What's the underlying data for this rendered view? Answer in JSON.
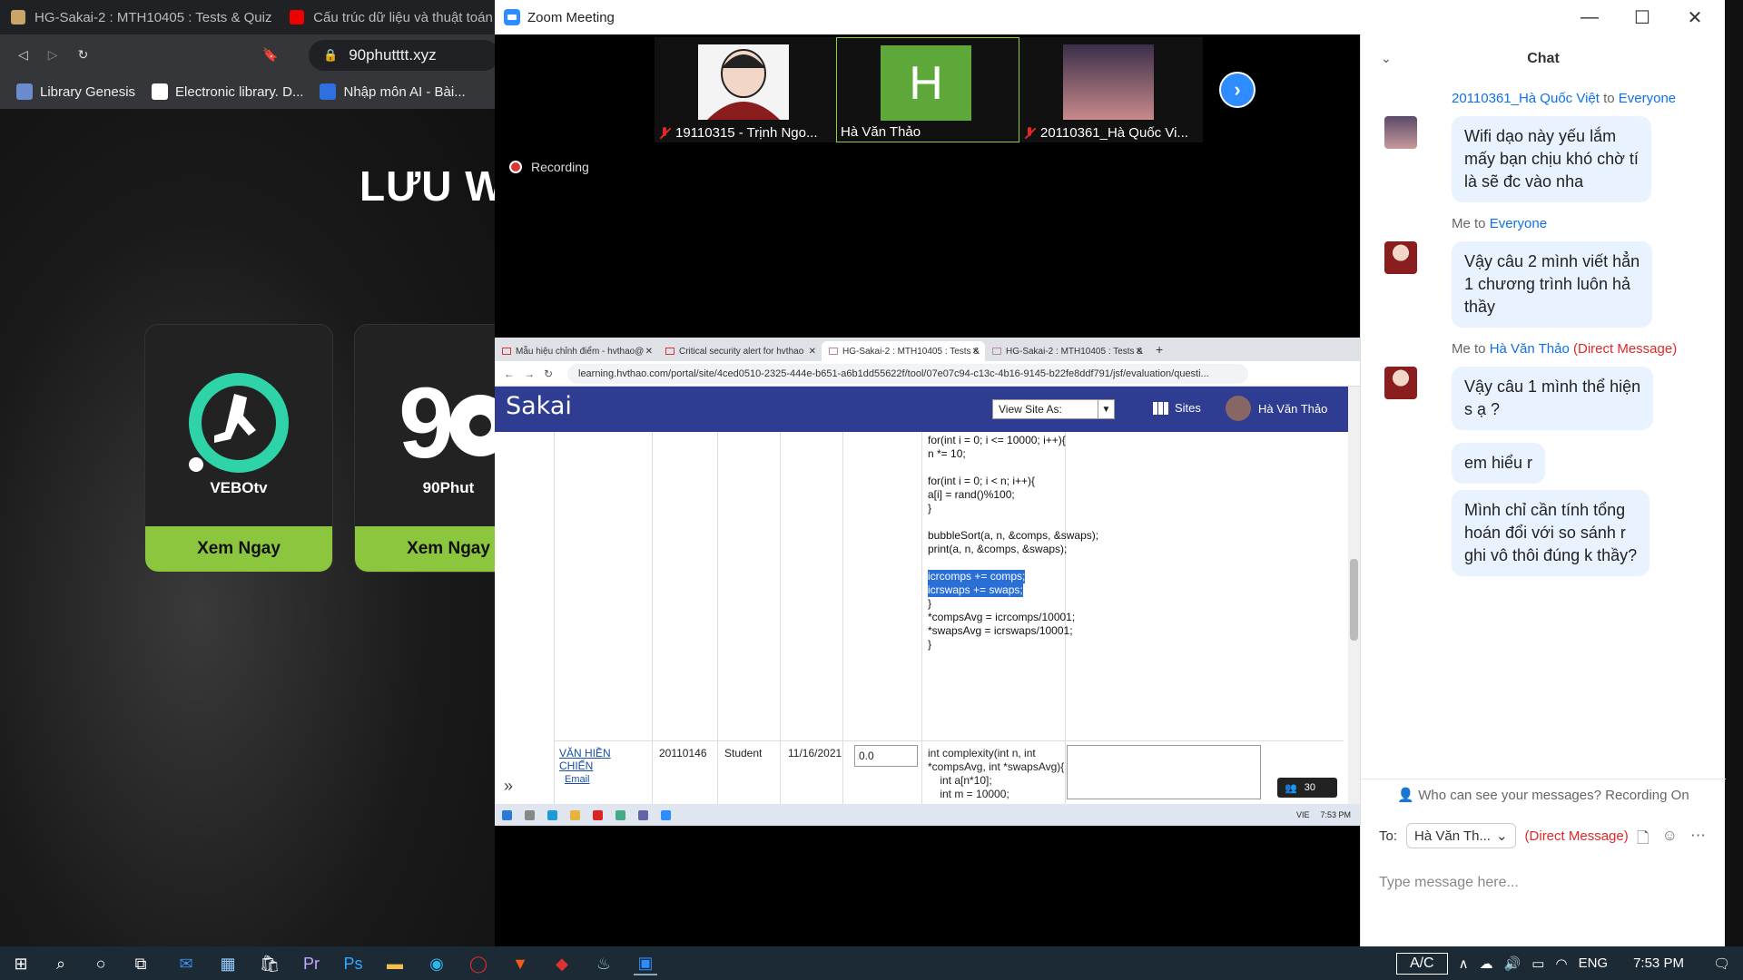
{
  "bg_browser": {
    "tabs": [
      {
        "title": "HG-Sakai-2 : MTH10405 : Tests & Quiz",
        "icon": "sakai-favicon"
      },
      {
        "title": "Cấu trúc dữ liệu và thuật toán",
        "icon": "youtube-favicon"
      }
    ],
    "url": "90phutttt.xyz",
    "bookmarks": [
      "Library Genesis",
      "Electronic library. D...",
      "Nhập môn AI - Bài..."
    ],
    "heading": "LƯU W",
    "cards": [
      {
        "name": "VEBOtv",
        "button": "Xem Ngay"
      },
      {
        "name": "90Phut",
        "button": "Xem Ngay"
      }
    ]
  },
  "zoom": {
    "title": "Zoom Meeting",
    "participants": [
      {
        "name": "19110315 - Trịnh Ngo...",
        "muted": true
      },
      {
        "name": "Hà Văn Thảo",
        "muted": false,
        "initial": "H"
      },
      {
        "name": "20110361_Hà Quốc Vi...",
        "muted": true
      }
    ],
    "recording_label": "Recording",
    "shared": {
      "tabs": [
        "Mẫu hiệu chỉnh điểm - hvthao@",
        "Critical security alert for hvthao",
        "HG-Sakai-2 : MTH10405 : Tests &",
        "HG-Sakai-2 : MTH10405 : Tests &"
      ],
      "url": "learning.hvthao.com/portal/site/4ced0510-2325-444e-b651-a6b1dd55622f/tool/07e07c94-c13c-4b16-9145-b22fe8ddf791/jsf/evaluation/questi...",
      "logo": "Sakai",
      "view_site_as": "View Site As:",
      "sites": "Sites",
      "user": "Hà Văn Thảo",
      "code_lines": [
        "for(int i = 0; i <= 10000; i++){",
        "n *= 10;",
        "",
        "for(int i = 0; i < n; i++){",
        "a[i] = rand()%100;",
        "}",
        "",
        "bubbleSort(a, n, &comps, &swaps);",
        "print(a, n, &comps, &swaps);",
        "",
        "icrcomps += comps;",
        "icrswaps += swaps;",
        "}",
        "*compsAvg = icrcomps/10001;",
        "*swapsAvg = icrswaps/10001;",
        "}"
      ],
      "row": {
        "student_name": "VĂN HIỀN CHIẾN",
        "email_link": "Email",
        "student_id": "20110146",
        "role": "Student",
        "date": "11/16/2021",
        "score": "0.0",
        "code": [
          "int complexity(int n, int",
          "*compsAvg, int *swapsAvg){",
          "    int a[n*10];",
          "    int m = 10000;"
        ]
      },
      "participant_count": "30",
      "tray_lang": "VIE",
      "tray_time": "7:53 PM"
    }
  },
  "chat": {
    "title": "Chat",
    "messages": [
      {
        "sender": "20110361_Hà Quốc Việt",
        "to_word": "to",
        "recipient": "Everyone",
        "dm": "",
        "texts": [
          "Wifi dạo này yếu lắm\nmấy bạn chịu khó chờ tí\nlà sẽ đc vào nha"
        ]
      },
      {
        "sender": "Me",
        "to_word": "to",
        "recipient": "Everyone",
        "dm": "",
        "texts": [
          "Vậy câu 2 mình viết hẳn\n1 chương trình luôn hả\nthầy"
        ]
      },
      {
        "sender": "Me",
        "to_word": "to",
        "recipient": "Hà Văn Thảo",
        "dm": "(Direct Message)",
        "texts": [
          "Vậy câu 1 mình thể hiện\ns ạ ?",
          "em hiểu r",
          "Mình chỉ cần tính tổng\nhoán đổi với so sánh r\nghi vô thôi đúng k thầy?"
        ]
      }
    ],
    "who_can_see": "Who can see your messages? Recording On",
    "to_label": "To:",
    "to_value": "Hà Văn Th...",
    "to_dm": "(Direct Message)",
    "input_placeholder": "Type message here..."
  },
  "taskbar": {
    "ac": "A/C",
    "lang": "ENG",
    "time": "7:53 PM"
  }
}
